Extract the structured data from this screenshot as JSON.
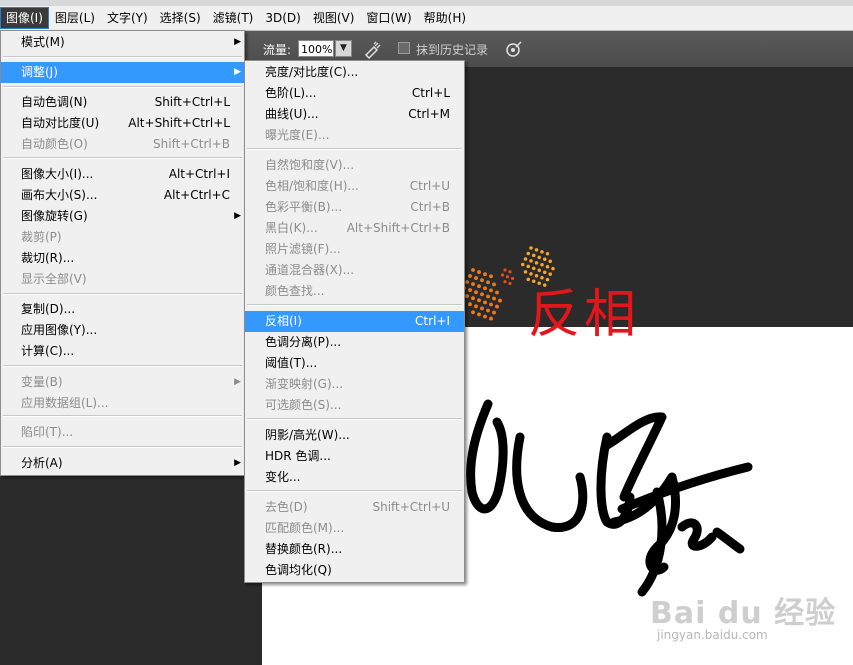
{
  "menubar": {
    "items": [
      "图像(I)",
      "图层(L)",
      "文字(Y)",
      "选择(S)",
      "滤镜(T)",
      "3D(D)",
      "视图(V)",
      "窗口(W)",
      "帮助(H)"
    ]
  },
  "options": {
    "flow_label": "流量:",
    "flow_value": "100%",
    "history_label": "抹到历史记录"
  },
  "image_menu": {
    "items": [
      {
        "label": "模式(M)",
        "shortcut": "",
        "submenu": true,
        "disabled": false
      },
      {
        "label": "调整(J)",
        "shortcut": "",
        "submenu": true,
        "disabled": false,
        "highlight": true
      },
      {
        "label": "自动色调(N)",
        "shortcut": "Shift+Ctrl+L",
        "disabled": false
      },
      {
        "label": "自动对比度(U)",
        "shortcut": "Alt+Shift+Ctrl+L",
        "disabled": false
      },
      {
        "label": "自动颜色(O)",
        "shortcut": "Shift+Ctrl+B",
        "disabled": true
      },
      {
        "label": "图像大小(I)...",
        "shortcut": "Alt+Ctrl+I",
        "disabled": false
      },
      {
        "label": "画布大小(S)...",
        "shortcut": "Alt+Ctrl+C",
        "disabled": false
      },
      {
        "label": "图像旋转(G)",
        "shortcut": "",
        "submenu": true,
        "disabled": false
      },
      {
        "label": "裁剪(P)",
        "shortcut": "",
        "disabled": true
      },
      {
        "label": "裁切(R)...",
        "shortcut": "",
        "disabled": false
      },
      {
        "label": "显示全部(V)",
        "shortcut": "",
        "disabled": true
      },
      {
        "label": "复制(D)...",
        "shortcut": "",
        "disabled": false
      },
      {
        "label": "应用图像(Y)...",
        "shortcut": "",
        "disabled": false
      },
      {
        "label": "计算(C)...",
        "shortcut": "",
        "disabled": false
      },
      {
        "label": "变量(B)",
        "shortcut": "",
        "submenu": true,
        "disabled": true
      },
      {
        "label": "应用数据组(L)...",
        "shortcut": "",
        "disabled": true
      },
      {
        "label": "陷印(T)...",
        "shortcut": "",
        "disabled": true
      },
      {
        "label": "分析(A)",
        "shortcut": "",
        "submenu": true,
        "disabled": false
      }
    ]
  },
  "adjust_menu": {
    "items": [
      {
        "label": "亮度/对比度(C)...",
        "shortcut": "",
        "disabled": false
      },
      {
        "label": "色阶(L)...",
        "shortcut": "Ctrl+L",
        "disabled": false
      },
      {
        "label": "曲线(U)...",
        "shortcut": "Ctrl+M",
        "disabled": false
      },
      {
        "label": "曝光度(E)...",
        "shortcut": "",
        "disabled": true
      },
      {
        "label": "自然饱和度(V)...",
        "shortcut": "",
        "disabled": true
      },
      {
        "label": "色相/饱和度(H)...",
        "shortcut": "Ctrl+U",
        "disabled": true
      },
      {
        "label": "色彩平衡(B)...",
        "shortcut": "Ctrl+B",
        "disabled": true
      },
      {
        "label": "黑白(K)...",
        "shortcut": "Alt+Shift+Ctrl+B",
        "disabled": true
      },
      {
        "label": "照片滤镜(F)...",
        "shortcut": "",
        "disabled": true
      },
      {
        "label": "通道混合器(X)...",
        "shortcut": "",
        "disabled": true
      },
      {
        "label": "颜色查找...",
        "shortcut": "",
        "disabled": true
      },
      {
        "label": "反相(I)",
        "shortcut": "Ctrl+I",
        "disabled": false,
        "highlight": true
      },
      {
        "label": "色调分离(P)...",
        "shortcut": "",
        "disabled": false
      },
      {
        "label": "阈值(T)...",
        "shortcut": "",
        "disabled": false
      },
      {
        "label": "渐变映射(G)...",
        "shortcut": "",
        "disabled": true
      },
      {
        "label": "可选颜色(S)...",
        "shortcut": "",
        "disabled": true
      },
      {
        "label": "阴影/高光(W)...",
        "shortcut": "",
        "disabled": false
      },
      {
        "label": "HDR 色调...",
        "shortcut": "",
        "disabled": false
      },
      {
        "label": "变化...",
        "shortcut": "",
        "disabled": false
      },
      {
        "label": "去色(D)",
        "shortcut": "Shift+Ctrl+U",
        "disabled": true
      },
      {
        "label": "匹配颜色(M)...",
        "shortcut": "",
        "disabled": true
      },
      {
        "label": "替换颜色(R)...",
        "shortcut": "",
        "disabled": false
      },
      {
        "label": "色调均化(Q)",
        "shortcut": "",
        "disabled": false
      }
    ]
  },
  "annotation": {
    "text": "反相",
    "color": "#e3161c"
  },
  "watermark": {
    "logo": "Bai du 经验",
    "url": "jingyan.baidu.com"
  },
  "colors": {
    "highlight": "#3399ff",
    "menu_bg": "#f0f0f0",
    "workspace": "#2b2b2b"
  }
}
